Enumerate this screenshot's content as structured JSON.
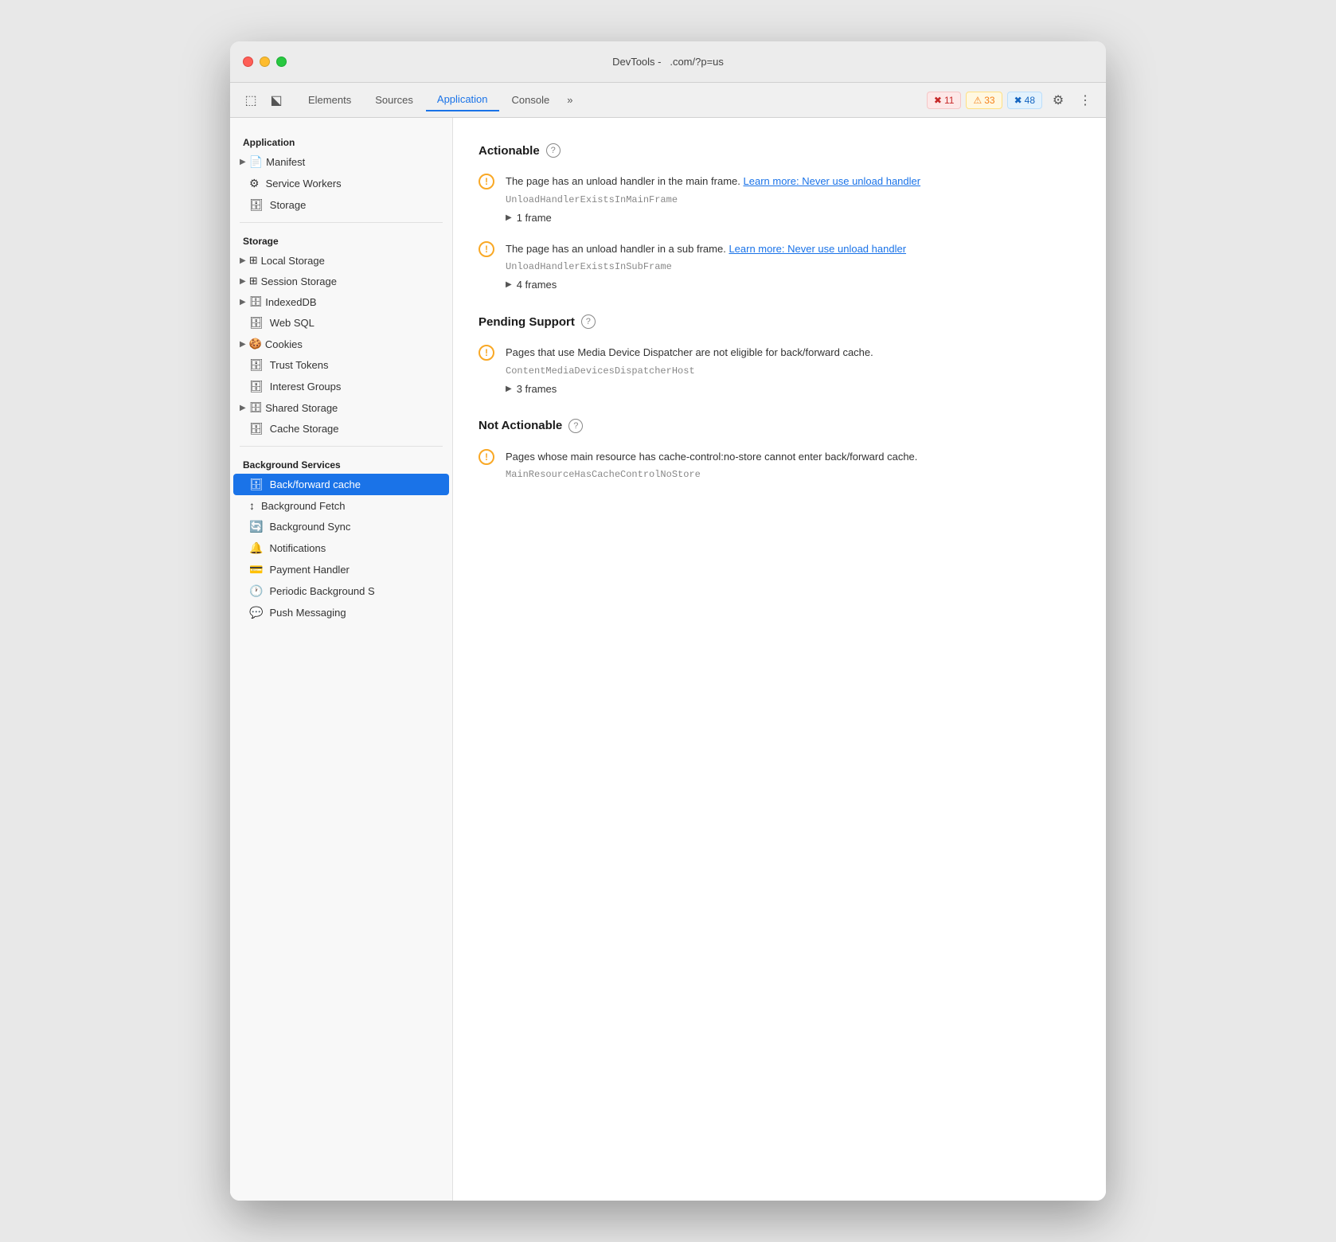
{
  "window": {
    "title": "DevTools -",
    "url": ".com/?p=us"
  },
  "toolbar": {
    "tabs": [
      {
        "id": "elements",
        "label": "Elements",
        "active": false
      },
      {
        "id": "sources",
        "label": "Sources",
        "active": false
      },
      {
        "id": "application",
        "label": "Application",
        "active": true
      },
      {
        "id": "console",
        "label": "Console",
        "active": false
      }
    ],
    "more_label": "»",
    "badge_errors": "11",
    "badge_warnings": "33",
    "badge_issues": "48"
  },
  "sidebar": {
    "app_section": "Application",
    "app_items": [
      {
        "id": "manifest",
        "label": "Manifest",
        "icon": "📄"
      },
      {
        "id": "service-workers",
        "label": "Service Workers",
        "icon": "⚙️"
      },
      {
        "id": "storage",
        "label": "Storage",
        "icon": "🗄️"
      }
    ],
    "storage_section": "Storage",
    "storage_items": [
      {
        "id": "local-storage",
        "label": "Local Storage",
        "expandable": true,
        "icon": "⊞"
      },
      {
        "id": "session-storage",
        "label": "Session Storage",
        "expandable": true,
        "icon": "⊞"
      },
      {
        "id": "indexeddb",
        "label": "IndexedDB",
        "expandable": true,
        "icon": "🗄️"
      },
      {
        "id": "web-sql",
        "label": "Web SQL",
        "expandable": false,
        "icon": "🗄️"
      },
      {
        "id": "cookies",
        "label": "Cookies",
        "expandable": true,
        "icon": "🍪"
      },
      {
        "id": "trust-tokens",
        "label": "Trust Tokens",
        "expandable": false,
        "icon": "🗄️"
      },
      {
        "id": "interest-groups",
        "label": "Interest Groups",
        "expandable": false,
        "icon": "🗄️"
      },
      {
        "id": "shared-storage",
        "label": "Shared Storage",
        "expandable": true,
        "icon": "🗄️"
      },
      {
        "id": "cache-storage",
        "label": "Cache Storage",
        "expandable": false,
        "icon": "🗄️"
      }
    ],
    "bg_section": "Background Services",
    "bg_items": [
      {
        "id": "back-forward-cache",
        "label": "Back/forward cache",
        "active": true,
        "icon": "🗄️"
      },
      {
        "id": "background-fetch",
        "label": "Background Fetch",
        "icon": "↕"
      },
      {
        "id": "background-sync",
        "label": "Background Sync",
        "icon": "🔄"
      },
      {
        "id": "notifications",
        "label": "Notifications",
        "icon": "🔔"
      },
      {
        "id": "payment-handler",
        "label": "Payment Handler",
        "icon": "💳"
      },
      {
        "id": "periodic-background",
        "label": "Periodic Background S",
        "icon": "🕐"
      },
      {
        "id": "push-messaging",
        "label": "Push Messaging",
        "icon": "💬"
      }
    ]
  },
  "content": {
    "sections": [
      {
        "id": "actionable",
        "title": "Actionable",
        "issues": [
          {
            "id": "unload-main-frame",
            "text": "The page has an unload handler in the main frame.",
            "link_text": "Learn more: Never use unload handler",
            "code": "UnloadHandlerExistsInMainFrame",
            "frames": "1 frame"
          },
          {
            "id": "unload-sub-frame",
            "text": "The page has an unload handler in a sub frame.",
            "link_text": "Learn more: Never use unload handler",
            "code": "UnloadHandlerExistsInSubFrame",
            "frames": "4 frames"
          }
        ]
      },
      {
        "id": "pending-support",
        "title": "Pending Support",
        "issues": [
          {
            "id": "media-device-dispatcher",
            "text": "Pages that use Media Device Dispatcher are not eligible for back/forward cache.",
            "link_text": "",
            "code": "ContentMediaDevicesDispatcherHost",
            "frames": "3 frames"
          }
        ]
      },
      {
        "id": "not-actionable",
        "title": "Not Actionable",
        "issues": [
          {
            "id": "cache-control-no-store",
            "text": "Pages whose main resource has cache-control:no-store cannot enter back/forward cache.",
            "link_text": "",
            "code": "MainResourceHasCacheControlNoStore",
            "frames": ""
          }
        ]
      }
    ]
  }
}
